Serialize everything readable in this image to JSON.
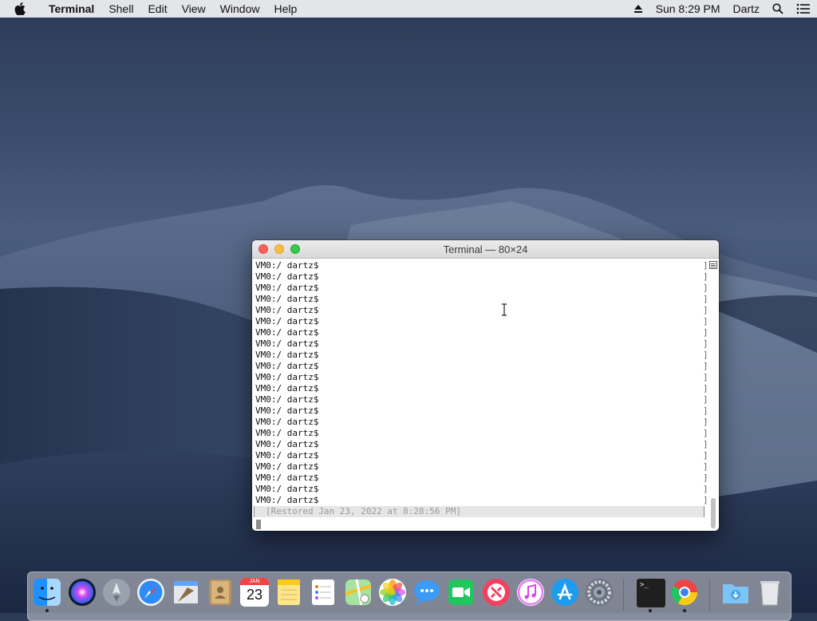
{
  "menubar": {
    "app": "Terminal",
    "menus": [
      "Shell",
      "Edit",
      "View",
      "Window",
      "Help"
    ],
    "clock": "Sun 8:29 PM",
    "user": "Dartz"
  },
  "window": {
    "title": "Terminal — 80×24",
    "prompt_lines": [
      "VM0:/ dartz$",
      "VM0:/ dartz$",
      "VM0:/ dartz$",
      "VM0:/ dartz$",
      "VM0:/ dartz$",
      "VM0:/ dartz$",
      "VM0:/ dartz$",
      "VM0:/ dartz$",
      "VM0:/ dartz$",
      "VM0:/ dartz$",
      "VM0:/ dartz$",
      "VM0:/ dartz$",
      "VM0:/ dartz$",
      "VM0:/ dartz$",
      "VM0:/ dartz$",
      "VM0:/ dartz$",
      "VM0:/ dartz$",
      "VM0:/ dartz$",
      "VM0:/ dartz$",
      "VM0:/ dartz$",
      "VM0:/ dartz$",
      "VM0:/ dartz$"
    ],
    "restored": "[Restored Jan 23, 2022 at 8:28:56 PM]"
  },
  "dock": {
    "calendar_month": "JAN",
    "calendar_day": "23",
    "terminal_glyph": ">_",
    "apps": [
      "finder",
      "siri",
      "launchpad",
      "safari",
      "mail",
      "contacts",
      "calendar",
      "notes",
      "reminders",
      "maps",
      "photos",
      "messages",
      "facetime",
      "news",
      "itunes",
      "app-store",
      "system-preferences",
      "terminal",
      "chrome",
      "downloads",
      "trash"
    ]
  },
  "colors": {
    "close": "#fc605b",
    "minimize": "#fdbc40",
    "maximize": "#34c84a"
  }
}
